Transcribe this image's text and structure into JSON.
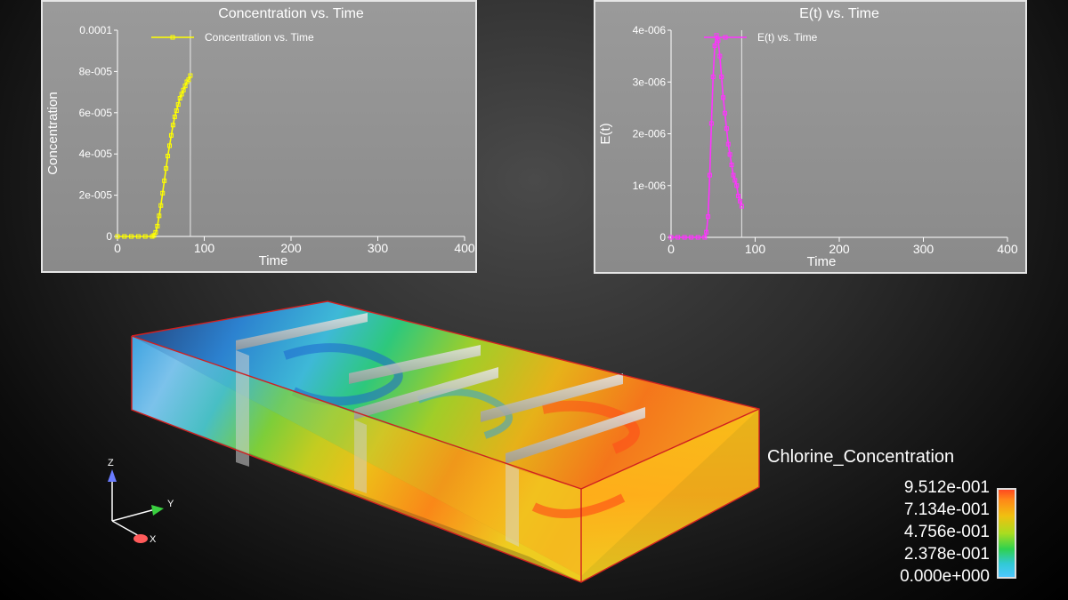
{
  "colorbar": {
    "title": "Chlorine_Concentration",
    "labels": [
      "9.512e-001",
      "7.134e-001",
      "4.756e-001",
      "2.378e-001",
      "0.000e+000"
    ]
  },
  "triad": {
    "z": "Z",
    "y": "Y",
    "x": "X"
  },
  "chart_data": [
    {
      "type": "line",
      "title": "Concentration vs. Time",
      "xlabel": "Time",
      "ylabel": "Concentration",
      "xlim": [
        0,
        400
      ],
      "ylim": [
        0,
        0.0001
      ],
      "x_ticks": [
        0,
        100,
        200,
        300,
        400
      ],
      "x_tick_labels": [
        "0",
        "100",
        "200",
        "300",
        "400"
      ],
      "y_ticks": [
        0,
        2e-05,
        4e-05,
        6e-05,
        8e-05,
        0.0001
      ],
      "y_tick_labels": [
        "0",
        "2e-005",
        "4e-005",
        "6e-005",
        "8e-005",
        "0.0001"
      ],
      "marker_line_x": 84,
      "legend": "top",
      "grid": false,
      "series": [
        {
          "name": "Concentration vs. Time",
          "color": "#ffff00",
          "x": [
            0,
            4,
            8,
            12,
            16,
            20,
            24,
            28,
            32,
            36,
            40,
            42,
            44,
            46,
            48,
            50,
            52,
            54,
            56,
            58,
            60,
            62,
            64,
            66,
            68,
            70,
            72,
            74,
            76,
            78,
            80,
            82,
            84
          ],
          "y": [
            0,
            0,
            0,
            0,
            0,
            0,
            0,
            0,
            0,
            0,
            0,
            5e-07,
            2e-06,
            5e-06,
            1e-05,
            1.5e-05,
            2.1e-05,
            2.7e-05,
            3.3e-05,
            3.9e-05,
            4.4e-05,
            4.9e-05,
            5.4e-05,
            5.8e-05,
            6.1e-05,
            6.4e-05,
            6.7e-05,
            6.9e-05,
            7.1e-05,
            7.3e-05,
            7.5e-05,
            7.6e-05,
            7.8e-05
          ]
        }
      ]
    },
    {
      "type": "line",
      "title": "E(t) vs. Time",
      "xlabel": "Time",
      "ylabel": "E(t)",
      "xlim": [
        0,
        400
      ],
      "ylim": [
        0,
        4e-06
      ],
      "x_ticks": [
        0,
        100,
        200,
        300,
        400
      ],
      "x_tick_labels": [
        "0",
        "100",
        "200",
        "300",
        "400"
      ],
      "y_ticks": [
        0,
        1e-06,
        2e-06,
        3e-06,
        4e-06
      ],
      "y_tick_labels": [
        "0",
        "1e-006",
        "2e-006",
        "3e-006",
        "4e-006"
      ],
      "marker_line_x": 84,
      "legend": "top",
      "grid": false,
      "series": [
        {
          "name": "E(t) vs. Time",
          "color": "#ff33ff",
          "x": [
            0,
            4,
            8,
            12,
            16,
            20,
            24,
            28,
            32,
            36,
            40,
            42,
            44,
            46,
            48,
            50,
            52,
            54,
            56,
            58,
            60,
            62,
            64,
            66,
            68,
            70,
            72,
            74,
            76,
            78,
            80,
            82,
            84
          ],
          "y": [
            0,
            0,
            0,
            0,
            0,
            0,
            0,
            0,
            0,
            0,
            0,
            1e-07,
            4e-07,
            1.2e-06,
            2.2e-06,
            3.1e-06,
            3.7e-06,
            3.9e-06,
            3.8e-06,
            3.5e-06,
            3.1e-06,
            2.7e-06,
            2.4e-06,
            2.1e-06,
            1.8e-06,
            1.6e-06,
            1.4e-06,
            1.2e-06,
            1.1e-06,
            1e-06,
            8e-07,
            7e-07,
            6e-07
          ]
        }
      ]
    }
  ]
}
